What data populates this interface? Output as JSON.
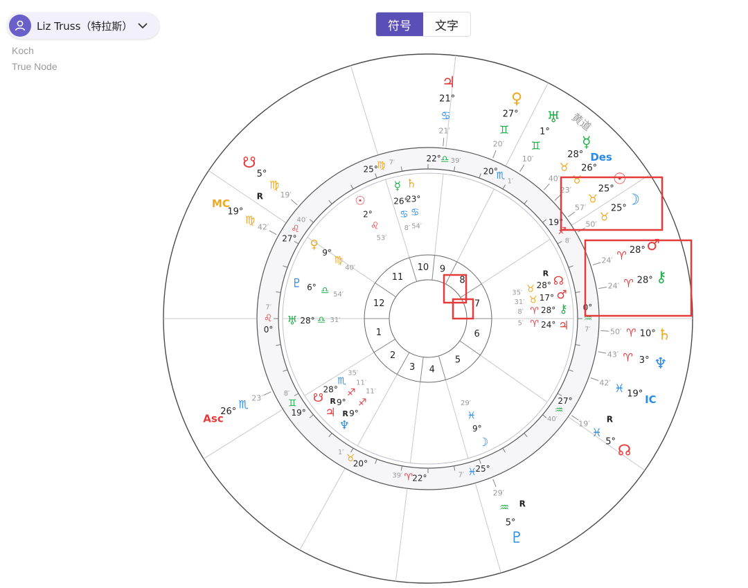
{
  "person": {
    "name": "Liz Truss（特拉斯）"
  },
  "settings": {
    "house_system": "Koch",
    "node_type": "True Node"
  },
  "toggle": {
    "symbol_label": "符号",
    "text_label": "文字",
    "active": "symbol"
  },
  "chart_data": {
    "type": "natal-wheel",
    "ecliptic_label": "黄道",
    "colors": {
      "fire": "#e53a3a",
      "earth": "#f0a820",
      "air": "#22b04a",
      "water": "#2a8ae8",
      "highlight": "#e53a3a"
    },
    "house_numbers": [
      "1",
      "2",
      "3",
      "4",
      "5",
      "6",
      "7",
      "8",
      "9",
      "10",
      "11",
      "12"
    ],
    "outer_planets": [
      {
        "name": "jupiter",
        "glyph": "♃",
        "sign": "♋",
        "deg": "21°",
        "min": "21′",
        "color": "#e53a3a",
        "signcolor": "#2a8ae8"
      },
      {
        "name": "venus",
        "glyph": "♀",
        "sign": "♊",
        "deg": "27°",
        "min": "20′",
        "color": "#f0a820",
        "signcolor": "#22b04a"
      },
      {
        "name": "uranus",
        "glyph": "♅",
        "sign": "♊",
        "deg": "1°",
        "min": "10′",
        "color": "#22b04a",
        "signcolor": "#22b04a"
      },
      {
        "name": "mercury",
        "glyph": "☿",
        "sign": "♉",
        "deg": "28°",
        "min": "40′",
        "color": "#22b04a",
        "signcolor": "#f0a820"
      },
      {
        "name": "descendant",
        "glyph": "Des",
        "sign": "♉",
        "deg": "26°",
        "min": "23′",
        "color": "#2a8ae8",
        "signcolor": "#f0a820"
      },
      {
        "name": "sun",
        "glyph": "☉",
        "sign": "♉",
        "deg": "25°",
        "min": "57′",
        "color": "#e53a3a",
        "signcolor": "#f0a820"
      },
      {
        "name": "moon",
        "glyph": "☽",
        "sign": "♉",
        "deg": "25°",
        "min": "50′",
        "color": "#2a8ae8",
        "signcolor": "#f0a820"
      },
      {
        "name": "mars",
        "glyph": "♂",
        "sign": "♈",
        "deg": "28°",
        "min": "24′",
        "color": "#e53a3a",
        "signcolor": "#e53a3a"
      },
      {
        "name": "chiron",
        "glyph": "⚷",
        "sign": "♈",
        "deg": "28°",
        "min": "24′",
        "color": "#22b04a",
        "signcolor": "#e53a3a"
      },
      {
        "name": "saturn",
        "glyph": "♄",
        "sign": "♈",
        "deg": "10°",
        "min": "50′",
        "color": "#f0a820",
        "signcolor": "#e53a3a"
      },
      {
        "name": "neptune",
        "glyph": "♆",
        "sign": "♈",
        "deg": "3°",
        "min": "43′",
        "color": "#2a8ae8",
        "signcolor": "#e53a3a"
      },
      {
        "name": "ic",
        "glyph": "IC",
        "sign": "♓",
        "deg": "19°",
        "min": "42′",
        "color": "#2a8ae8",
        "signcolor": "#2a8ae8"
      },
      {
        "name": "north-node",
        "glyph": "☊",
        "sign": "♓",
        "deg": "5°",
        "min": "19′",
        "color": "#e53a3a",
        "signcolor": "#2a8ae8",
        "retro": "R"
      },
      {
        "name": "pluto",
        "glyph": "♇",
        "sign": "♒",
        "deg": "5°",
        "min": "29′",
        "color": "#2a8ae8",
        "signcolor": "#22b04a",
        "retro": "R"
      },
      {
        "name": "ascendant",
        "glyph": "Asc",
        "sign": "♏",
        "deg": "26°",
        "min": "23′",
        "color": "#e53a3a",
        "signcolor": "#2a8ae8"
      },
      {
        "name": "midheaven",
        "glyph": "MC",
        "sign": "♍",
        "deg": "19°",
        "min": "42′",
        "color": "#f0a820",
        "signcolor": "#f0a820"
      },
      {
        "name": "south-node",
        "glyph": "☋",
        "sign": "♍",
        "deg": "5°",
        "min": "19′",
        "color": "#e53a3a",
        "signcolor": "#f0a820",
        "retro": "R"
      }
    ],
    "cusps": [
      {
        "deg": "0°",
        "sign": "♌",
        "min": "7′",
        "signcolor": "#e53a3a"
      },
      {
        "deg": "19°",
        "sign": "♊",
        "min": "8′",
        "signcolor": "#22b04a"
      },
      {
        "deg": "20°",
        "sign": "♉",
        "min": "1′",
        "signcolor": "#f0a820"
      },
      {
        "deg": "22°",
        "sign": "♈",
        "min": "39′",
        "signcolor": "#e53a3a"
      },
      {
        "deg": "25°",
        "sign": "♓",
        "min": "7′",
        "signcolor": "#2a8ae8"
      },
      {
        "deg": "27°",
        "sign": "♒",
        "min": "40′",
        "signcolor": "#22b04a"
      },
      {
        "deg": "0°",
        "sign": "♒",
        "min": "7′",
        "signcolor": "#22b04a"
      },
      {
        "deg": "19°",
        "sign": "♐",
        "min": "8′",
        "signcolor": "#e53a3a"
      },
      {
        "deg": "20°",
        "sign": "♏",
        "min": "1′",
        "signcolor": "#2a8ae8"
      },
      {
        "deg": "22°",
        "sign": "♎",
        "min": "39′",
        "signcolor": "#22b04a"
      },
      {
        "deg": "25°",
        "sign": "♍",
        "min": "7′",
        "signcolor": "#f0a820"
      },
      {
        "deg": "27°",
        "sign": "♌",
        "min": "40′",
        "signcolor": "#e53a3a"
      }
    ],
    "inner_planets": [
      {
        "name": "sun",
        "glyph": "☉",
        "deg": "2°",
        "sign": "♌",
        "min": "53′",
        "color": "#e53a3a",
        "signcolor": "#e53a3a"
      },
      {
        "name": "mercury",
        "glyph": "☿",
        "deg": "26°",
        "sign": "♋",
        "min": "8′",
        "color": "#22b04a",
        "signcolor": "#2a8ae8"
      },
      {
        "name": "saturn",
        "glyph": "♄",
        "deg": "23°",
        "sign": "♋",
        "min": "54′",
        "color": "#f0a820",
        "signcolor": "#2a8ae8"
      },
      {
        "name": "venus",
        "glyph": "♀",
        "deg": "9°",
        "sign": "♍",
        "min": "40′",
        "color": "#f0a820",
        "signcolor": "#f0a820"
      },
      {
        "name": "pluto",
        "glyph": "♇",
        "deg": "6°",
        "sign": "♎",
        "min": "54′",
        "color": "#2a8ae8",
        "signcolor": "#22b04a"
      },
      {
        "name": "uranus",
        "glyph": "♅",
        "deg": "28°",
        "sign": "♎",
        "min": "31′",
        "color": "#22b04a",
        "signcolor": "#22b04a"
      },
      {
        "name": "south-node",
        "glyph": "☋",
        "deg": "28°",
        "sign": "♏",
        "min": "35′",
        "color": "#e53a3a",
        "signcolor": "#2a8ae8",
        "retro": "R"
      },
      {
        "name": "jupiter",
        "glyph": "♃",
        "deg": "9°",
        "sign": "♐",
        "min": "11′",
        "color": "#e53a3a",
        "signcolor": "#e53a3a",
        "retro": "R"
      },
      {
        "name": "neptune",
        "glyph": "♆",
        "deg": "9°",
        "sign": "♐",
        "min": "11′",
        "color": "#2a8ae8",
        "signcolor": "#e53a3a"
      },
      {
        "name": "moon",
        "glyph": "☽",
        "deg": "9°",
        "sign": "♓",
        "min": "29′",
        "color": "#2a8ae8",
        "signcolor": "#2a8ae8"
      },
      {
        "name": "north-node",
        "glyph": "☊",
        "deg": "28°",
        "sign": "♉",
        "min": "35′",
        "color": "#e53a3a",
        "signcolor": "#f0a820",
        "retro": "R"
      },
      {
        "name": "mars",
        "glyph": "♂",
        "deg": "17°",
        "sign": "♉",
        "min": "31′",
        "color": "#e53a3a",
        "signcolor": "#f0a820"
      },
      {
        "name": "chiron",
        "glyph": "⚷",
        "deg": "28°",
        "sign": "♈",
        "min": "8′",
        "color": "#22b04a",
        "signcolor": "#e53a3a"
      },
      {
        "name": "jupiter-2",
        "glyph": "♃",
        "deg": "24°",
        "sign": "♈",
        "min": "5′",
        "color": "#e53a3a",
        "signcolor": "#e53a3a"
      }
    ],
    "retro_label": "R"
  }
}
